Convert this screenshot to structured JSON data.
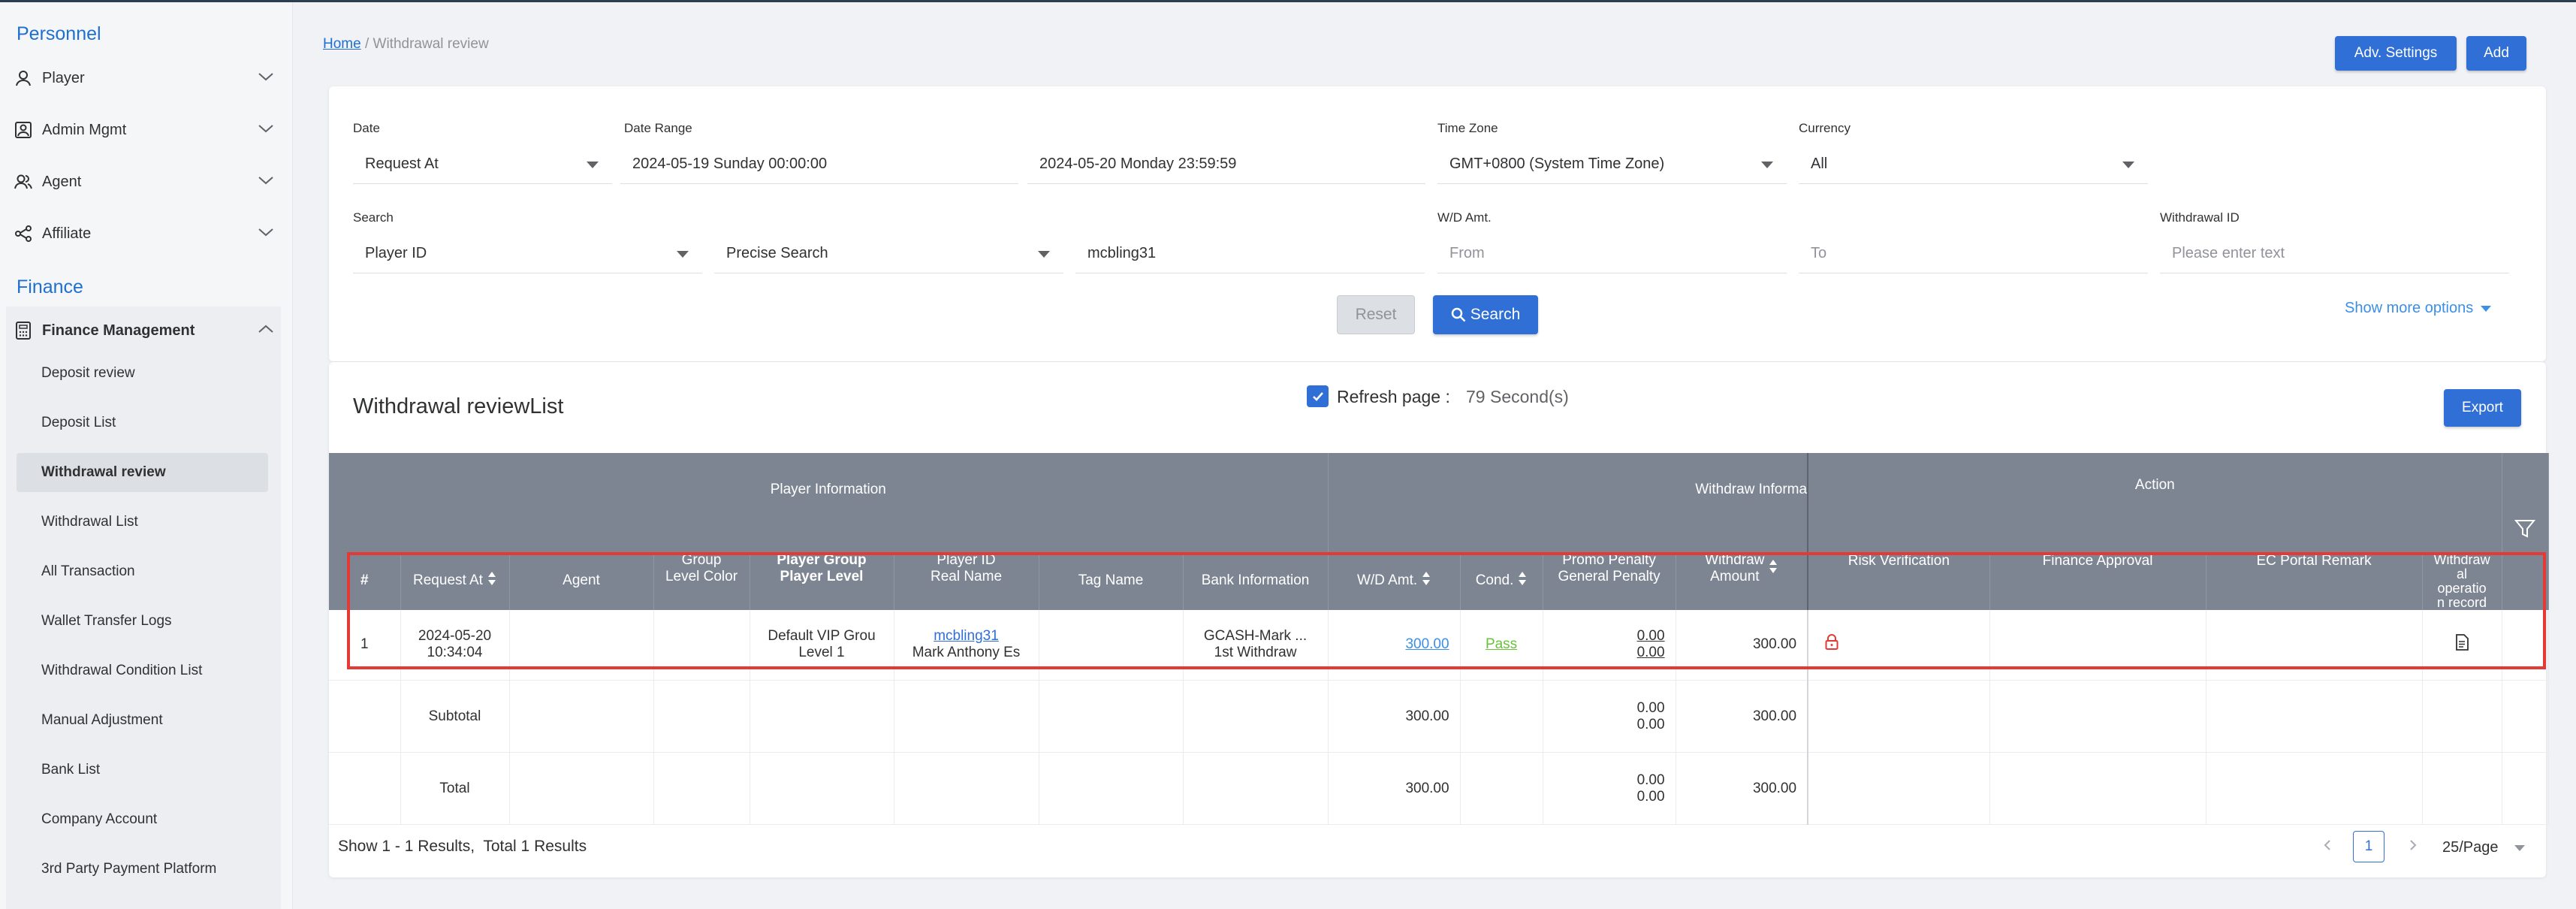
{
  "sidebar": {
    "personnel_title": "Personnel",
    "personnel_items": [
      {
        "label": "Player",
        "icon": "user-icon"
      },
      {
        "label": "Admin Mgmt",
        "icon": "admin-card-icon"
      },
      {
        "label": "Agent",
        "icon": "users-icon"
      },
      {
        "label": "Affiliate",
        "icon": "share-icon"
      }
    ],
    "finance_title": "Finance",
    "finance_group": {
      "label": "Finance Management",
      "icon": "calculator-icon"
    },
    "finance_items": [
      "Deposit review",
      "Deposit List",
      "Withdrawal review",
      "Withdrawal List",
      "All Transaction",
      "Wallet Transfer Logs",
      "Withdrawal Condition List",
      "Manual Adjustment",
      "Bank List",
      "Company Account",
      "3rd Party Payment Platform"
    ],
    "active_item": "Withdrawal review"
  },
  "breadcrumb": {
    "home": "Home",
    "separator": " / ",
    "current": "Withdrawal review"
  },
  "header_buttons": {
    "adv_settings": "Adv. Settings",
    "add": "Add"
  },
  "filters": {
    "date_label": "Date",
    "date_value": "Request At",
    "date_range_label": "Date Range",
    "date_from": "2024-05-19 Sunday 00:00:00",
    "date_to": "2024-05-20 Monday 23:59:59",
    "timezone_label": "Time Zone",
    "timezone_value": "GMT+0800 (System Time Zone)",
    "currency_label": "Currency",
    "currency_value": "All",
    "search_label": "Search",
    "search_field": "Player ID",
    "search_mode": "Precise Search",
    "search_value": "mcbling31",
    "wd_amt_label": "W/D Amt.",
    "wd_from_placeholder": "From",
    "wd_to_placeholder": "To",
    "withdrawal_id_label": "Withdrawal ID",
    "withdrawal_id_placeholder": "Please enter text",
    "reset": "Reset",
    "search": "Search",
    "show_more": "Show more options"
  },
  "list": {
    "title": "Withdrawal reviewList",
    "refresh_label": "Refresh page :",
    "refresh_value": "79 Second(s)",
    "refresh_checked": true,
    "export": "Export"
  },
  "table": {
    "group_headers": {
      "player_info": "Player Information",
      "withdraw_info": "Withdraw Informa",
      "action": "Action"
    },
    "columns": {
      "index": "#",
      "request_at": "Request At",
      "agent": "Agent",
      "group_level_color": [
        "Group",
        "Level Color"
      ],
      "player_group": [
        "Player Group",
        "Player Level"
      ],
      "player_id": [
        "Player ID",
        "Real Name"
      ],
      "tag_name": "Tag Name",
      "bank_info": "Bank Information",
      "wd_amt": "W/D Amt.",
      "cond": "Cond.",
      "penalty": [
        "Promo Penalty",
        "General Penalty"
      ],
      "withdraw_amount": [
        "Withdraw",
        "Amount"
      ],
      "risk": "Risk Verification",
      "finance": "Finance Approval",
      "ec_remark": "EC Portal Remark",
      "withdraw_record": [
        "Withdraw",
        "al",
        "operatio",
        "n record"
      ]
    },
    "rows": [
      {
        "index": "1",
        "request_date": "2024-05-20",
        "request_time": "10:34:04",
        "agent": "",
        "group_level_color": "",
        "player_group": "Default VIP Grou",
        "player_level": "Level 1",
        "player_id": "mcbling31",
        "real_name": "Mark Anthony Es",
        "tag_name": "",
        "bank_line1": "GCASH-Mark ...",
        "bank_line2": "1st Withdraw",
        "wd_amt": "300.00",
        "cond": "Pass",
        "promo_penalty": "0.00",
        "general_penalty": "0.00",
        "withdraw_amount": "300.00"
      }
    ],
    "subtotal": {
      "label": "Subtotal",
      "wd_amt": "300.00",
      "promo_penalty": "0.00",
      "general_penalty": "0.00",
      "withdraw_amount": "300.00"
    },
    "total": {
      "label": "Total",
      "wd_amt": "300.00",
      "promo_penalty": "0.00",
      "general_penalty": "0.00",
      "withdraw_amount": "300.00"
    }
  },
  "footer": {
    "results": "Show 1 - 1 Results,  Total 1 Results",
    "current_page": "1",
    "page_size": "25/Page"
  },
  "colors": {
    "accent": "#2f6fd6",
    "header_bg": "#7d8593",
    "pass": "#67c23a",
    "highlight": "#e53935"
  }
}
